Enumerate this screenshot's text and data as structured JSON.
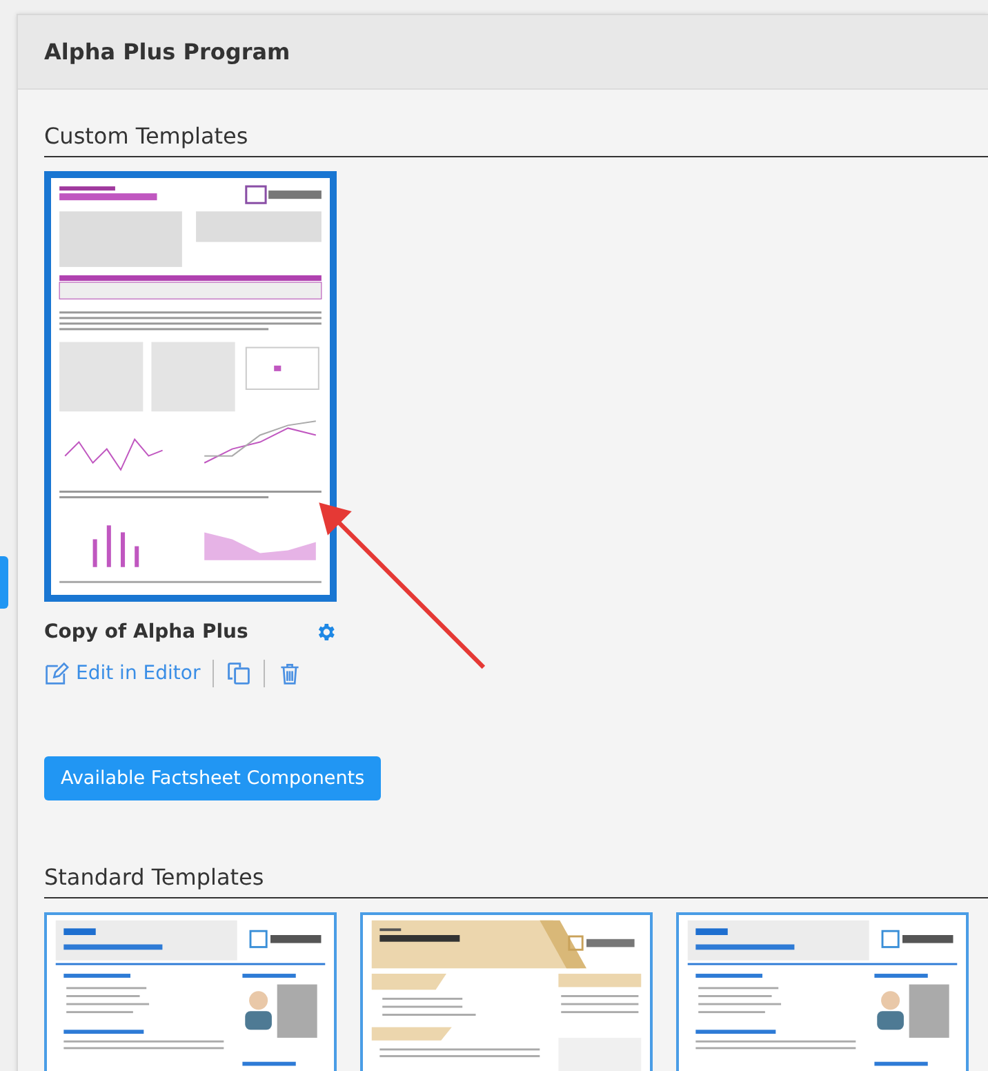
{
  "panel": {
    "title": "Alpha Plus Program"
  },
  "custom_templates": {
    "heading": "Custom Templates",
    "items": [
      {
        "name": "Copy of Alpha Plus",
        "kind": "report",
        "selected": true,
        "edit_label": "Edit in Editor"
      }
    ]
  },
  "components_button": "Available Factsheet Components",
  "standard_templates": {
    "heading": "Standard Templates",
    "items": [
      {
        "kind": "classic",
        "selected": false
      },
      {
        "kind": "banner",
        "selected": false
      },
      {
        "kind": "classic",
        "selected": false
      }
    ]
  }
}
